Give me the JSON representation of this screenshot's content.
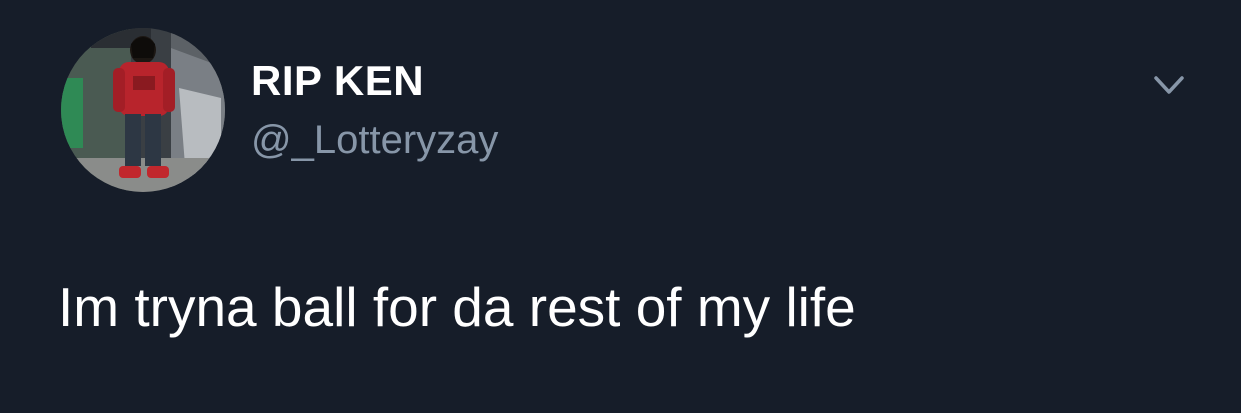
{
  "tweet": {
    "author": {
      "display_name": "RIP KEN",
      "handle": "@_Lotteryzay"
    },
    "text": "Im tryna ball for da rest of my life",
    "menu_icon": "chevron-down-icon"
  },
  "colors": {
    "background": "#161d29",
    "name_text": "#ffffff",
    "handle_text": "#8796a8",
    "body_text": "#ffffff"
  }
}
